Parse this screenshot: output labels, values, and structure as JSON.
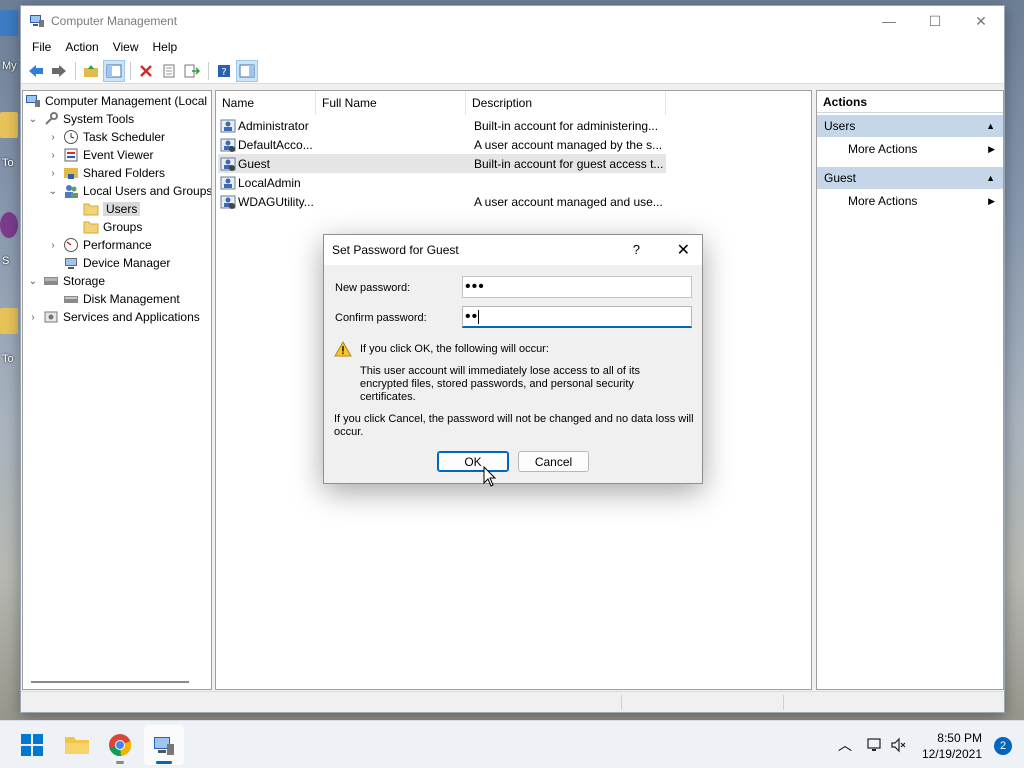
{
  "desktop": {
    "labels": [
      "My",
      "To",
      "S",
      "To"
    ]
  },
  "window": {
    "title": "Computer Management",
    "menu": [
      "File",
      "Action",
      "View",
      "Help"
    ]
  },
  "tree": {
    "items": [
      {
        "label": "Computer Management (Local",
        "icon": "computer-management-icon"
      },
      {
        "label": "System Tools",
        "icon": "system-tools-icon"
      },
      {
        "label": "Task Scheduler",
        "icon": "clock-icon"
      },
      {
        "label": "Event Viewer",
        "icon": "event-viewer-icon"
      },
      {
        "label": "Shared Folders",
        "icon": "shared-folder-icon"
      },
      {
        "label": "Local Users and Groups",
        "icon": "users-groups-icon"
      },
      {
        "label": "Users",
        "icon": "folder-icon"
      },
      {
        "label": "Groups",
        "icon": "folder-icon"
      },
      {
        "label": "Performance",
        "icon": "performance-icon"
      },
      {
        "label": "Device Manager",
        "icon": "device-manager-icon"
      },
      {
        "label": "Storage",
        "icon": "storage-icon"
      },
      {
        "label": "Disk Management",
        "icon": "disk-icon"
      },
      {
        "label": "Services and Applications",
        "icon": "services-icon"
      }
    ]
  },
  "list": {
    "columns": [
      "Name",
      "Full Name",
      "Description"
    ],
    "rows": [
      {
        "name": "Administrator",
        "full_name": "",
        "description": "Built-in account for administering..."
      },
      {
        "name": "DefaultAcco...",
        "full_name": "",
        "description": "A user account managed by the s..."
      },
      {
        "name": "Guest",
        "full_name": "",
        "description": "Built-in account for guest access t..."
      },
      {
        "name": "LocalAdmin",
        "full_name": "",
        "description": ""
      },
      {
        "name": "WDAGUtility...",
        "full_name": "",
        "description": "A user account managed and use..."
      }
    ]
  },
  "actions": {
    "title": "Actions",
    "sections": [
      {
        "label": "Users",
        "item": "More Actions"
      },
      {
        "label": "Guest",
        "item": "More Actions"
      }
    ]
  },
  "dialog": {
    "title": "Set Password for Guest",
    "help": "?",
    "new_password_label": "New password:",
    "new_password_value": "•••",
    "confirm_password_label": "Confirm password:",
    "confirm_password_value": "••",
    "warning_heading": "If you click OK, the following will occur:",
    "warning_body": "This user account will immediately lose access to all of its encrypted files, stored passwords, and personal security certificates.",
    "cancel_note": "If you click Cancel, the password will not be changed and no data loss will occur.",
    "ok_label": "OK",
    "cancel_label": "Cancel"
  },
  "taskbar": {
    "time": "8:50 PM",
    "date": "12/19/2021",
    "notifications": "2"
  },
  "colors": {
    "accent": "#0067c0",
    "selection": "#c5d6e8"
  }
}
